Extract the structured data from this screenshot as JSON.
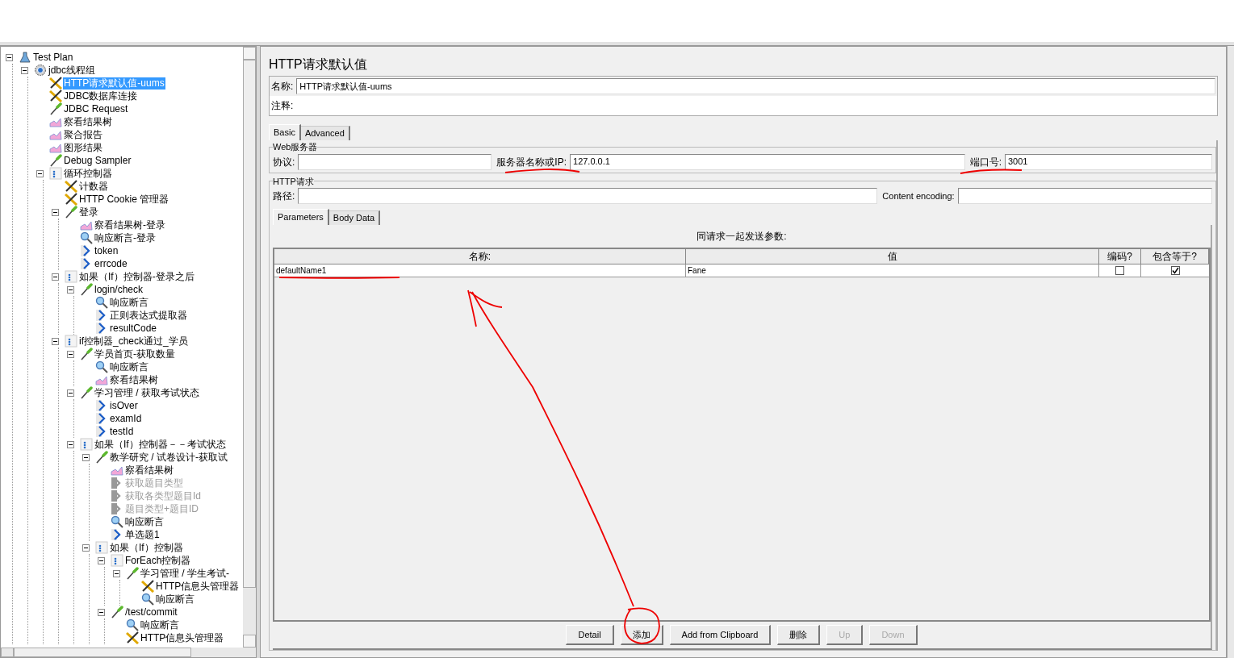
{
  "tree": {
    "items": [
      {
        "label": "Test Plan",
        "kind": "plan",
        "expanded": true,
        "selected": false,
        "disabled": false,
        "children": [
          {
            "label": "jdbc线程组",
            "kind": "threadgroup",
            "expanded": true,
            "selected": false,
            "disabled": false,
            "children": [
              {
                "label": "HTTP请求默认值-uums",
                "kind": "config",
                "selected": true,
                "disabled": false
              },
              {
                "label": "JDBC数据库连接",
                "kind": "config",
                "selected": false,
                "disabled": false
              },
              {
                "label": "JDBC Request",
                "kind": "sampler",
                "selected": false,
                "disabled": false
              },
              {
                "label": "察看结果树",
                "kind": "listener",
                "selected": false,
                "disabled": false
              },
              {
                "label": "聚合报告",
                "kind": "listener",
                "selected": false,
                "disabled": false
              },
              {
                "label": "图形结果",
                "kind": "listener",
                "selected": false,
                "disabled": false
              },
              {
                "label": "Debug Sampler",
                "kind": "sampler",
                "selected": false,
                "disabled": false
              },
              {
                "label": "循环控制器",
                "kind": "controller",
                "expanded": true,
                "selected": false,
                "disabled": false,
                "children": [
                  {
                    "label": "计数器",
                    "kind": "config",
                    "selected": false,
                    "disabled": false
                  },
                  {
                    "label": "HTTP Cookie 管理器",
                    "kind": "config",
                    "selected": false,
                    "disabled": false
                  },
                  {
                    "label": "登录",
                    "kind": "sampler",
                    "expanded": true,
                    "selected": false,
                    "disabled": false,
                    "children": [
                      {
                        "label": "察看结果树-登录",
                        "kind": "listener",
                        "selected": false,
                        "disabled": false
                      },
                      {
                        "label": "响应断言-登录",
                        "kind": "assertion",
                        "selected": false,
                        "disabled": false
                      },
                      {
                        "label": "token",
                        "kind": "extractor",
                        "selected": false,
                        "disabled": false
                      },
                      {
                        "label": "errcode",
                        "kind": "extractor",
                        "selected": false,
                        "disabled": false
                      }
                    ]
                  },
                  {
                    "label": "如果（If）控制器-登录之后",
                    "kind": "controller",
                    "expanded": true,
                    "selected": false,
                    "disabled": false,
                    "children": [
                      {
                        "label": "login/check",
                        "kind": "sampler",
                        "expanded": true,
                        "selected": false,
                        "disabled": false,
                        "children": [
                          {
                            "label": "响应断言",
                            "kind": "assertion",
                            "selected": false,
                            "disabled": false
                          },
                          {
                            "label": "正则表达式提取器",
                            "kind": "extractor",
                            "selected": false,
                            "disabled": false
                          },
                          {
                            "label": "resultCode",
                            "kind": "extractor",
                            "selected": false,
                            "disabled": false
                          }
                        ]
                      }
                    ]
                  },
                  {
                    "label": "if控制器_check通过_学员",
                    "kind": "controller",
                    "expanded": true,
                    "selected": false,
                    "disabled": false,
                    "children": [
                      {
                        "label": "学员首页-获取数量",
                        "kind": "sampler",
                        "expanded": true,
                        "selected": false,
                        "disabled": false,
                        "children": [
                          {
                            "label": "响应断言",
                            "kind": "assertion",
                            "selected": false,
                            "disabled": false
                          },
                          {
                            "label": "察看结果树",
                            "kind": "listener",
                            "selected": false,
                            "disabled": false
                          }
                        ]
                      },
                      {
                        "label": "学习管理 / 获取考试状态",
                        "kind": "sampler",
                        "expanded": true,
                        "selected": false,
                        "disabled": false,
                        "children": [
                          {
                            "label": "isOver",
                            "kind": "extractor",
                            "selected": false,
                            "disabled": false
                          },
                          {
                            "label": "examId",
                            "kind": "extractor",
                            "selected": false,
                            "disabled": false
                          },
                          {
                            "label": "testId",
                            "kind": "extractor",
                            "selected": false,
                            "disabled": false
                          }
                        ]
                      },
                      {
                        "label": "如果（If）控制器－－考试状态",
                        "kind": "controller",
                        "expanded": true,
                        "selected": false,
                        "disabled": false,
                        "children": [
                          {
                            "label": "教学研究 / 试卷设计-获取试",
                            "kind": "sampler",
                            "expanded": true,
                            "selected": false,
                            "disabled": false,
                            "children": [
                              {
                                "label": "察看结果树",
                                "kind": "listener",
                                "selected": false,
                                "disabled": false
                              },
                              {
                                "label": "获取题目类型",
                                "kind": "extractor",
                                "selected": false,
                                "disabled": true
                              },
                              {
                                "label": "获取各类型题目Id",
                                "kind": "extractor",
                                "selected": false,
                                "disabled": true
                              },
                              {
                                "label": "题目类型+题目ID",
                                "kind": "extractor",
                                "selected": false,
                                "disabled": true
                              },
                              {
                                "label": "响应断言",
                                "kind": "assertion",
                                "selected": false,
                                "disabled": false
                              },
                              {
                                "label": "单选题1",
                                "kind": "extractor",
                                "selected": false,
                                "disabled": false
                              }
                            ]
                          },
                          {
                            "label": "如果（If）控制器",
                            "kind": "controller",
                            "expanded": true,
                            "selected": false,
                            "disabled": false,
                            "children": [
                              {
                                "label": "ForEach控制器",
                                "kind": "controller",
                                "expanded": true,
                                "selected": false,
                                "disabled": false,
                                "children": [
                                  {
                                    "label": "学习管理 / 学生考试-",
                                    "kind": "sampler",
                                    "expanded": true,
                                    "selected": false,
                                    "disabled": false,
                                    "children": [
                                      {
                                        "label": "HTTP信息头管理器",
                                        "kind": "config",
                                        "selected": false,
                                        "disabled": false
                                      },
                                      {
                                        "label": "响应断言",
                                        "kind": "assertion",
                                        "selected": false,
                                        "disabled": false
                                      }
                                    ]
                                  }
                                ]
                              },
                              {
                                "label": "/test/commit",
                                "kind": "sampler",
                                "expanded": true,
                                "selected": false,
                                "disabled": false,
                                "children": [
                                  {
                                    "label": "响应断言",
                                    "kind": "assertion",
                                    "selected": false,
                                    "disabled": false
                                  },
                                  {
                                    "label": "HTTP信息头管理器",
                                    "kind": "config",
                                    "selected": false,
                                    "disabled": false
                                  }
                                ]
                              }
                            ]
                          }
                        ]
                      }
                    ]
                  }
                ]
              }
            ]
          }
        ]
      }
    ]
  },
  "editor": {
    "title": "HTTP请求默认值",
    "name_label": "名称:",
    "name_value": "HTTP请求默认值-uums",
    "comment_label": "注释:",
    "tabs": [
      {
        "label": "Basic",
        "selected": true
      },
      {
        "label": "Advanced",
        "selected": false
      }
    ],
    "web_server": {
      "legend": "Web服务器",
      "protocol_label": "协议:",
      "server_label": "服务器名称或IP:",
      "server_value": "127.0.0.1",
      "port_label": "端口号:",
      "port_value": "3001"
    },
    "http_request": {
      "legend": "HTTP请求",
      "path_label": "路径:",
      "encoding_label": "Content encoding:",
      "tabs": [
        {
          "label": "Parameters",
          "selected": true
        },
        {
          "label": "Body Data",
          "selected": false
        }
      ],
      "parameters": {
        "caption": "同请求一起发送参数:",
        "columns": [
          "名称:",
          "值",
          "编码?",
          "包含等于?"
        ],
        "rows": [
          {
            "name": "defaultName1",
            "value": "Fane",
            "encode": false,
            "include_equals": true
          }
        ]
      }
    },
    "buttons": [
      {
        "label": "Detail",
        "disabled": false
      },
      {
        "label": "添加",
        "disabled": false
      },
      {
        "label": "Add from Clipboard",
        "disabled": false
      },
      {
        "label": "删除",
        "disabled": false
      },
      {
        "label": "Up",
        "disabled": true
      },
      {
        "label": "Down",
        "disabled": true
      }
    ]
  }
}
